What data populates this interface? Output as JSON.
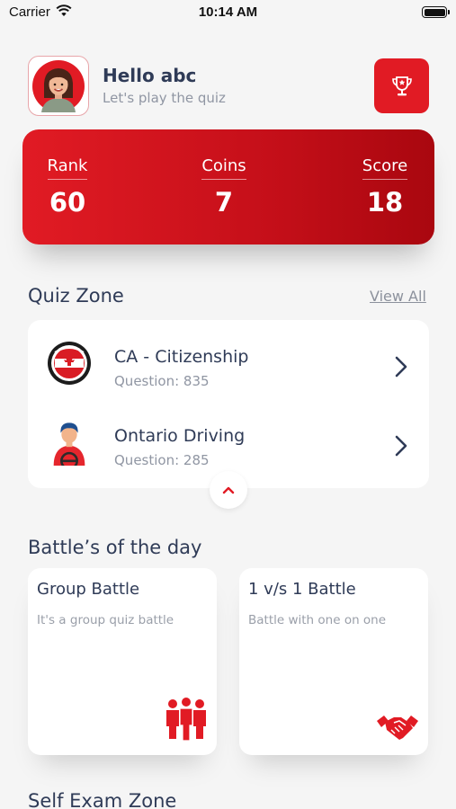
{
  "status_bar": {
    "carrier": "Carrier",
    "time": "10:14 AM"
  },
  "header": {
    "greeting": "Hello abc",
    "subtitle": "Let's play the quiz"
  },
  "stats": [
    {
      "label": "Rank",
      "value": "60"
    },
    {
      "label": "Coins",
      "value": "7"
    },
    {
      "label": "Score",
      "value": "18"
    }
  ],
  "quiz_zone": {
    "title": "Quiz Zone",
    "view_all": "View All",
    "items": [
      {
        "name": "CA - Citizenship",
        "count": "Question: 835",
        "icon": "citizenship-badge-icon"
      },
      {
        "name": "Ontario Driving",
        "count": "Question: 285",
        "icon": "driver-icon"
      }
    ]
  },
  "battles": {
    "title": "Battle’s of the day",
    "items": [
      {
        "title": "Group Battle",
        "desc": "It's a group quiz battle",
        "icon": "group-people-icon"
      },
      {
        "title": "1 v/s 1 Battle",
        "desc": "Battle with one on one",
        "icon": "handshake-icon"
      }
    ]
  },
  "self_exam": {
    "title": "Self Exam Zone"
  },
  "colors": {
    "accent": "#e11b24",
    "text": "#2f3b57",
    "muted": "#9096a3",
    "background": "#f5f5f5"
  }
}
